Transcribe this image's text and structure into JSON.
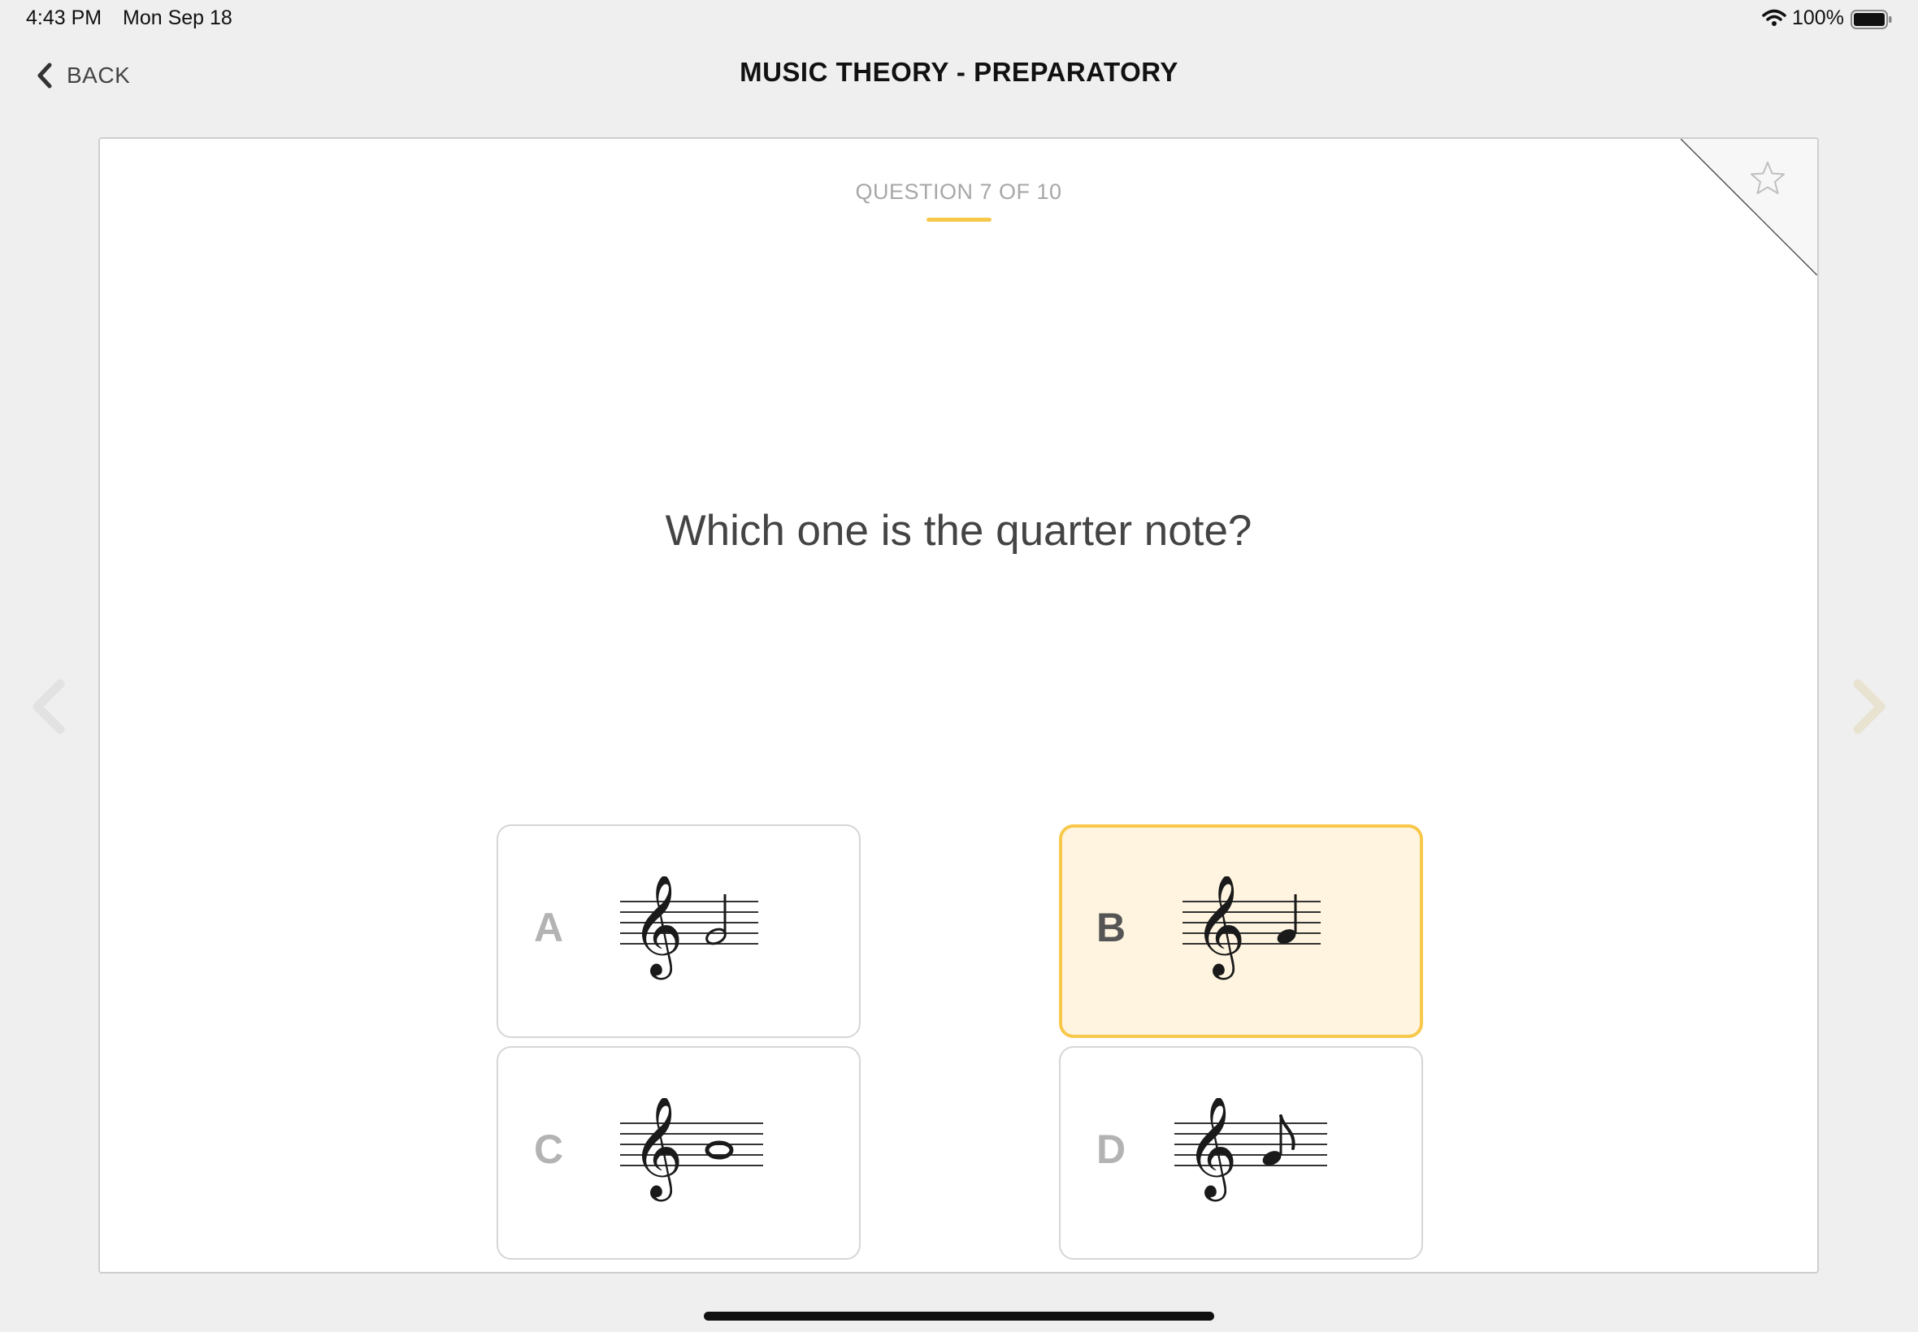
{
  "status_bar": {
    "time": "4:43 PM",
    "date": "Mon Sep 18",
    "battery": "100%",
    "icons": [
      "wifi-icon",
      "battery-icon"
    ]
  },
  "header": {
    "back_label": "BACK",
    "title": "MUSIC THEORY - PREPARATORY"
  },
  "quiz": {
    "counter": "QUESTION 7 OF 10",
    "question": "Which one is the quarter note?",
    "options": [
      {
        "letter": "A",
        "note": "half note",
        "selected": false
      },
      {
        "letter": "B",
        "note": "quarter note",
        "selected": true
      },
      {
        "letter": "C",
        "note": "whole note",
        "selected": false
      },
      {
        "letter": "D",
        "note": "eighth note",
        "selected": false
      }
    ]
  },
  "colors": {
    "accent": "#f8c84b",
    "selected_bg": "#fef4e0",
    "background": "#efefef",
    "card": "#ffffff"
  }
}
